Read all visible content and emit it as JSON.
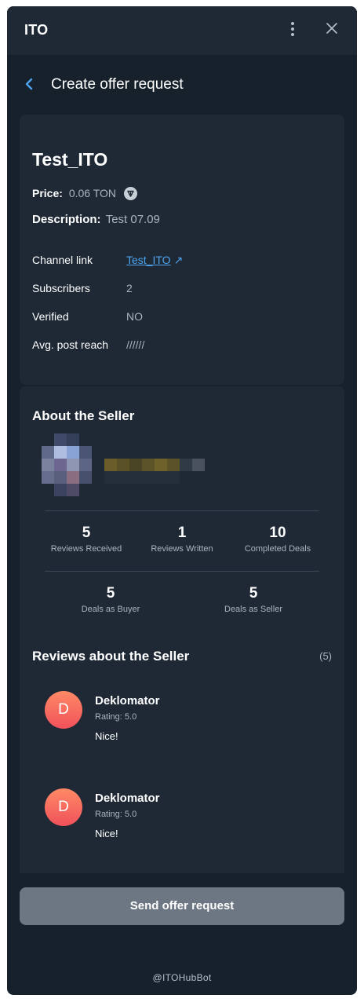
{
  "window": {
    "title": "ITO"
  },
  "header": {
    "title": "Create offer request"
  },
  "offer": {
    "name": "Test_ITO",
    "price_label": "Price:",
    "price_value": "0.06 TON",
    "description_label": "Description:",
    "description_value": "Test 07.09",
    "details": [
      {
        "label": "Channel link",
        "value": "Test_ITO",
        "is_link": true
      },
      {
        "label": "Subscribers",
        "value": "2"
      },
      {
        "label": "Verified",
        "value": "NO"
      },
      {
        "label": "Avg. post reach",
        "value": "//////"
      }
    ],
    "link_arrow": "↗"
  },
  "seller": {
    "title": "About the Seller",
    "stats_row1": [
      {
        "value": "5",
        "label": "Reviews Received"
      },
      {
        "value": "1",
        "label": "Reviews Written"
      },
      {
        "value": "10",
        "label": "Completed Deals"
      }
    ],
    "stats_row2": [
      {
        "value": "5",
        "label": "Deals as Buyer"
      },
      {
        "value": "5",
        "label": "Deals as Seller"
      }
    ]
  },
  "reviews": {
    "title": "Reviews about the Seller",
    "count": "(5)",
    "items": [
      {
        "initial": "D",
        "name": "Deklomator",
        "rating": "Rating: 5.0",
        "text": "Nice!"
      },
      {
        "initial": "D",
        "name": "Deklomator",
        "rating": "Rating: 5.0",
        "text": "Nice!"
      }
    ]
  },
  "actions": {
    "send_label": "Send offer request"
  },
  "footer": {
    "text": "@ITOHubBot"
  },
  "colors": {
    "background": "#17212b",
    "card": "#1f2935",
    "link": "#4ea4ee",
    "button": "#6d7783",
    "avatar_gradient": [
      "#ff8a65",
      "#f0515b"
    ]
  }
}
